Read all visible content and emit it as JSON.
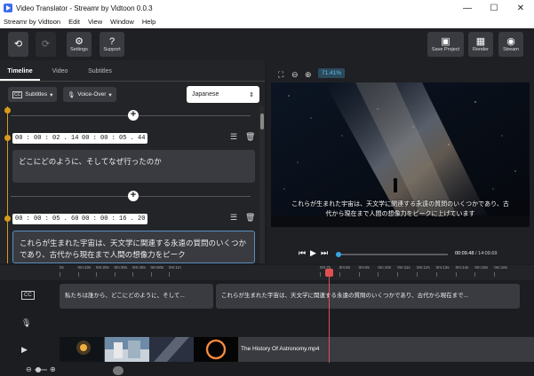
{
  "window": {
    "title": "Video Translator - Streamr by Vidtoon 0.0.3",
    "min": "—",
    "max": "☐",
    "close": "✕"
  },
  "menu": [
    "Streamr by Vidtoon",
    "Edit",
    "View",
    "Window",
    "Help"
  ],
  "toolbar": {
    "undo_icon": "undo-icon",
    "redo_icon": "redo-icon",
    "settings": "Settings",
    "support": "Support",
    "save_project": "Save Project",
    "render": "Render",
    "stream": "Stream"
  },
  "left_tabs": [
    "Timeline",
    "Video",
    "Subtitles"
  ],
  "controls": {
    "subtitles": "Subtitles",
    "voiceover": "Voice-Over",
    "language": "Japanese"
  },
  "cues": [
    {
      "start": "00 : 00 : 02 . 14",
      "end": "00 : 00 : 05 . 44",
      "text": "どこにどのように、そしてなぜ行ったのか"
    },
    {
      "start": "00 : 00 : 05 . 60",
      "end": "00 : 00 : 16 . 20",
      "text": "これらが生まれた宇宙は、天文学に関連する永遠の質問のいくつかであり、古代から現在まで人間の想像力をピーク"
    }
  ],
  "preview": {
    "zoom": "71.41%",
    "subtitle_line1": "これらが生まれた宇宙は、天文学に関連する永遠の質問のいくつかであり、古",
    "subtitle_line2": "代から現在まで人間の想像力をピークに上げています",
    "current_time": "00:09.48",
    "total_time": "14:09.69",
    "progress": 0.01
  },
  "ruler": [
    "0s",
    "0m:10s",
    "0m:20s",
    "0m:30s",
    "0m:40s",
    "0m:50s",
    "0m:1m",
    "0m:7s",
    "0m:8s",
    "0m:9s",
    "0m:10s",
    "0m:11s",
    "0m:12s",
    "0m:13s",
    "0m:14s",
    "0m:15s",
    "0m:16s"
  ],
  "tracks": {
    "clip1": "私たちは誰から、どこにどのように、そして...",
    "clip2": "これらが生まれた宇宙は、天文学に関連する永遠の質問のいくつかであり、古代から現在まで...",
    "video_title": "The History Of Astronomy.mp4"
  },
  "colors": {
    "accent": "#37a6e0",
    "timeline": "#d79a1a",
    "playhead": "#e05050"
  }
}
